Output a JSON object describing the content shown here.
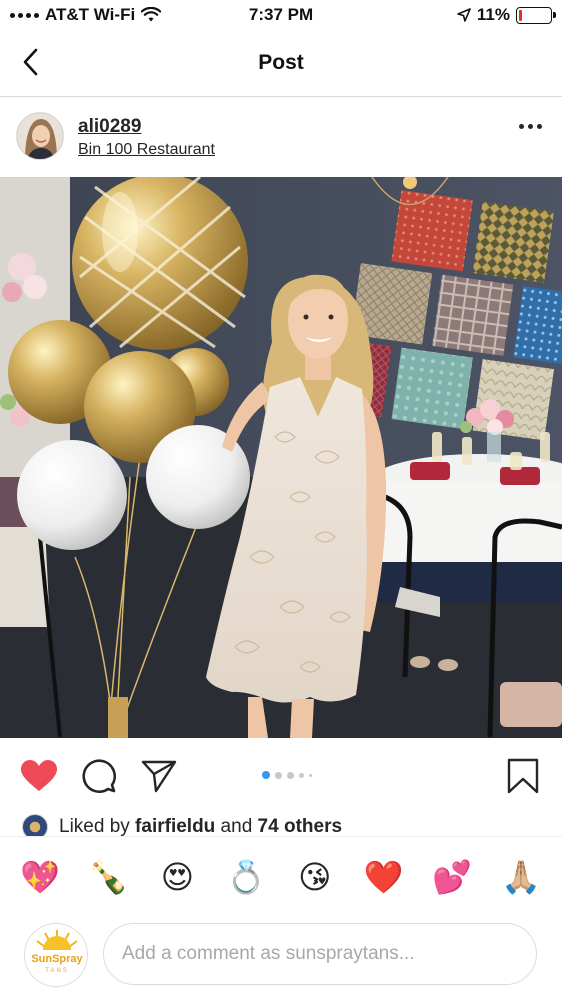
{
  "status_bar": {
    "carrier": "AT&T Wi-Fi",
    "time": "7:37 PM",
    "battery": "11%",
    "battery_level": 0.11
  },
  "nav": {
    "title": "Post"
  },
  "post": {
    "username": "ali0289",
    "location": "Bin 100 Restaurant",
    "carousel_total": 5,
    "carousel_active": 1
  },
  "likes": {
    "prefix": "Liked by ",
    "liker": "fairfieldu",
    "middle": " and ",
    "others": "74 others"
  },
  "composer": {
    "emojis": [
      "💖",
      "🍾",
      "😍",
      "💍",
      "😘",
      "❤️",
      "💕",
      "🙏🏼"
    ],
    "placeholder": "Add a comment as sunspraytans...",
    "avatar_text_top": "SunSpray",
    "avatar_text_bottom": "TANS"
  },
  "colors": {
    "heart": "#ed4956",
    "carousel_active": "#3897f0",
    "carousel_inactive": "#c7c7c7"
  }
}
